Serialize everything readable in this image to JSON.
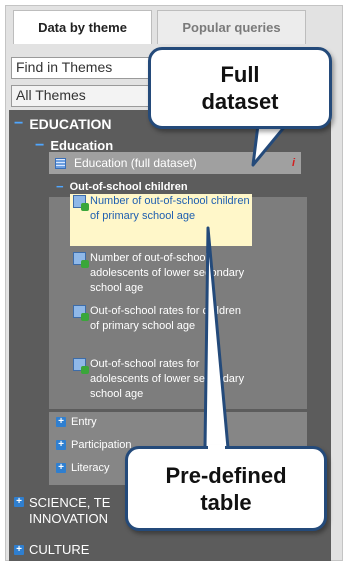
{
  "tabs": [
    {
      "label": "Data by theme",
      "active": true
    },
    {
      "label": "Popular queries",
      "active": false
    }
  ],
  "search": {
    "value": "Find in Themes"
  },
  "theme_select": {
    "value": "All Themes"
  },
  "tree": {
    "education": {
      "toggle": "−",
      "label": "EDUCATION"
    },
    "education_sub": {
      "toggle": "−",
      "label": "Education"
    },
    "full_dataset": {
      "label": "Education (full dataset)",
      "info": "i"
    },
    "out_of_school": {
      "toggle": "−",
      "label": "Out-of-school children"
    },
    "items": [
      {
        "label": "Number of out-of-school children of primary school age"
      },
      {
        "label": "Number of out-of-school adolescents of lower secondary school age"
      },
      {
        "label": "Out-of-school rates for children of primary school age"
      },
      {
        "label": "Out-of-school rates for adolescents of lower secondary school age"
      }
    ],
    "collapsed": [
      {
        "toggle": "+",
        "label": "Entry"
      },
      {
        "toggle": "+",
        "label": "Participation"
      },
      {
        "toggle": "+",
        "label": "Literacy"
      }
    ],
    "science": {
      "toggle": "+",
      "label_line1": "SCIENCE, TE",
      "label_line2": "INNOVATION"
    },
    "culture": {
      "toggle": "+",
      "label": "CULTURE"
    }
  },
  "callouts": {
    "full": {
      "line1": "Full",
      "line2": "dataset"
    },
    "predefined": {
      "line1": "Pre-defined",
      "line2": "table"
    }
  },
  "colors": {
    "callout_border": "#244a7a",
    "highlight": "#fff7c9",
    "toggle_blue": "#2f7fd0"
  }
}
